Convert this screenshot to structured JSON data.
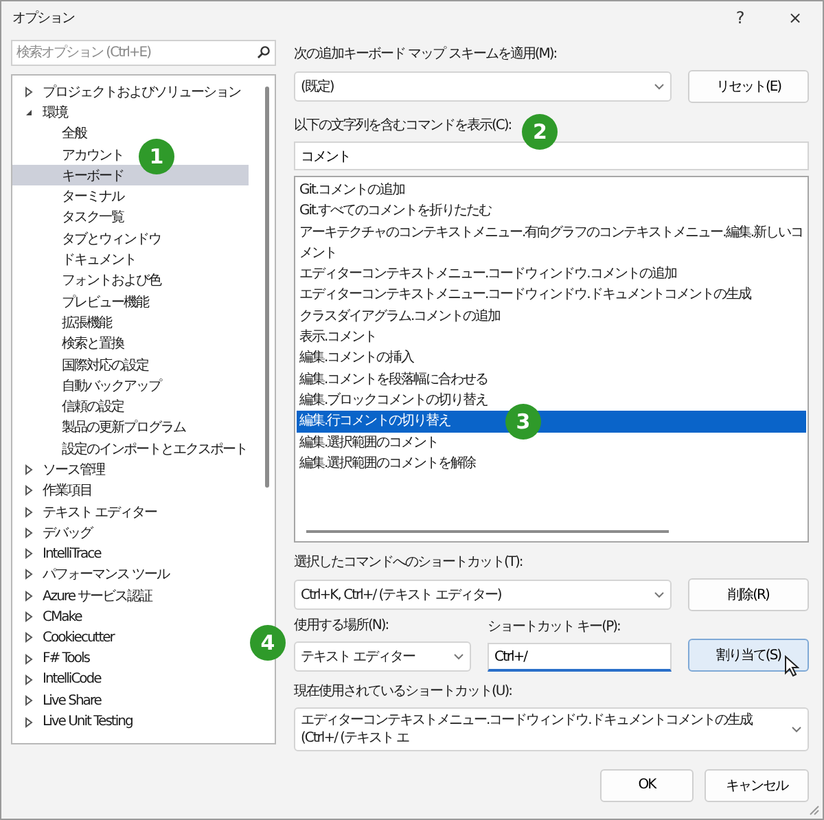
{
  "window": {
    "title": "オプション",
    "help": "?",
    "close": "×"
  },
  "search": {
    "placeholder": "検索オプション (Ctrl+E)"
  },
  "tree": [
    {
      "label": "プロジェクトおよびソリューション",
      "expanded": false,
      "selected": false
    },
    {
      "label": "環境",
      "expanded": true,
      "selected": false,
      "children": [
        {
          "label": "全般",
          "selected": false
        },
        {
          "label": "アカウント",
          "selected": false
        },
        {
          "label": "キーボード",
          "selected": true,
          "callout": "1"
        },
        {
          "label": "ターミナル",
          "selected": false
        },
        {
          "label": "タスク一覧",
          "selected": false
        },
        {
          "label": "タブとウィンドウ",
          "selected": false
        },
        {
          "label": "ドキュメント",
          "selected": false
        },
        {
          "label": "フォントおよび色",
          "selected": false
        },
        {
          "label": "プレビュー機能",
          "selected": false
        },
        {
          "label": "拡張機能",
          "selected": false
        },
        {
          "label": "検索と置換",
          "selected": false
        },
        {
          "label": "国際対応の設定",
          "selected": false
        },
        {
          "label": "自動バックアップ",
          "selected": false
        },
        {
          "label": "信頼の設定",
          "selected": false
        },
        {
          "label": "製品の更新プログラム",
          "selected": false
        },
        {
          "label": "設定のインポートとエクスポート",
          "selected": false
        }
      ]
    },
    {
      "label": "ソース管理",
      "expanded": false,
      "selected": false
    },
    {
      "label": "作業項目",
      "expanded": false,
      "selected": false
    },
    {
      "label": "テキスト エディター",
      "expanded": false,
      "selected": false
    },
    {
      "label": "デバッグ",
      "expanded": false,
      "selected": false
    },
    {
      "label": "IntelliTrace",
      "expanded": false,
      "selected": false
    },
    {
      "label": "パフォーマンス ツール",
      "expanded": false,
      "selected": false
    },
    {
      "label": "Azure サービス認証",
      "expanded": false,
      "selected": false
    },
    {
      "label": "CMake",
      "expanded": false,
      "selected": false
    },
    {
      "label": "Cookiecutter",
      "expanded": false,
      "selected": false
    },
    {
      "label": "F# Tools",
      "expanded": false,
      "selected": false
    },
    {
      "label": "IntelliCode",
      "expanded": false,
      "selected": false
    },
    {
      "label": "Live Share",
      "expanded": false,
      "selected": false
    },
    {
      "label": "Live Unit Testing",
      "expanded": false,
      "selected": false
    }
  ],
  "mapping_scheme": {
    "label": "次の追加キーボード マップ スキームを適用(M):",
    "value": "(既定)",
    "button": "リセット(E)"
  },
  "command_filter": {
    "label": "以下の文字列を含むコマンドを表示(C):",
    "value": "コメント",
    "callout": "2"
  },
  "commands": [
    {
      "label": "Git.コメントの追加",
      "selected": false
    },
    {
      "label": "Git.すべてのコメントを折りたたむ",
      "selected": false
    },
    {
      "label": "アーキテクチャのコンテキストメニュー.有向グラフのコンテキストメニュー.編集.新しいコメント",
      "selected": false
    },
    {
      "label": "エディターコンテキストメニュー.コードウィンドウ.コメントの追加",
      "selected": false
    },
    {
      "label": "エディターコンテキストメニュー.コードウィンドウ.ドキュメントコメントの生成",
      "selected": false
    },
    {
      "label": "クラスダイアグラム.コメントの追加",
      "selected": false
    },
    {
      "label": "表示.コメント",
      "selected": false
    },
    {
      "label": "編集.コメントの挿入",
      "selected": false
    },
    {
      "label": "編集.コメントを段落幅に合わせる",
      "selected": false
    },
    {
      "label": "編集.ブロックコメントの切り替え",
      "selected": false
    },
    {
      "label": "編集.行コメントの切り替え",
      "selected": true,
      "callout": "3"
    },
    {
      "label": "編集.選択範囲のコメント",
      "selected": false
    },
    {
      "label": "編集.選択範囲のコメントを解除",
      "selected": false
    }
  ],
  "selected_shortcuts": {
    "label": "選択したコマンドへのショートカット(T):",
    "value": "Ctrl+K, Ctrl+/ (テキスト エディター)",
    "button": "削除(R)"
  },
  "scope": {
    "label": "使用する場所(N):",
    "value": "テキスト エディター",
    "callout": "4"
  },
  "shortcut_key": {
    "label": "ショートカット キー(P):",
    "value": "Ctrl+/",
    "button": "割り当て(S)"
  },
  "current_usage": {
    "label": "現在使用されているショートカット(U):",
    "value": "エディターコンテキストメニュー.コードウィンドウ.ドキュメントコメントの生成 (Ctrl+/ (テキスト エ"
  },
  "footer": {
    "ok": "OK",
    "cancel": "キャンセル"
  }
}
